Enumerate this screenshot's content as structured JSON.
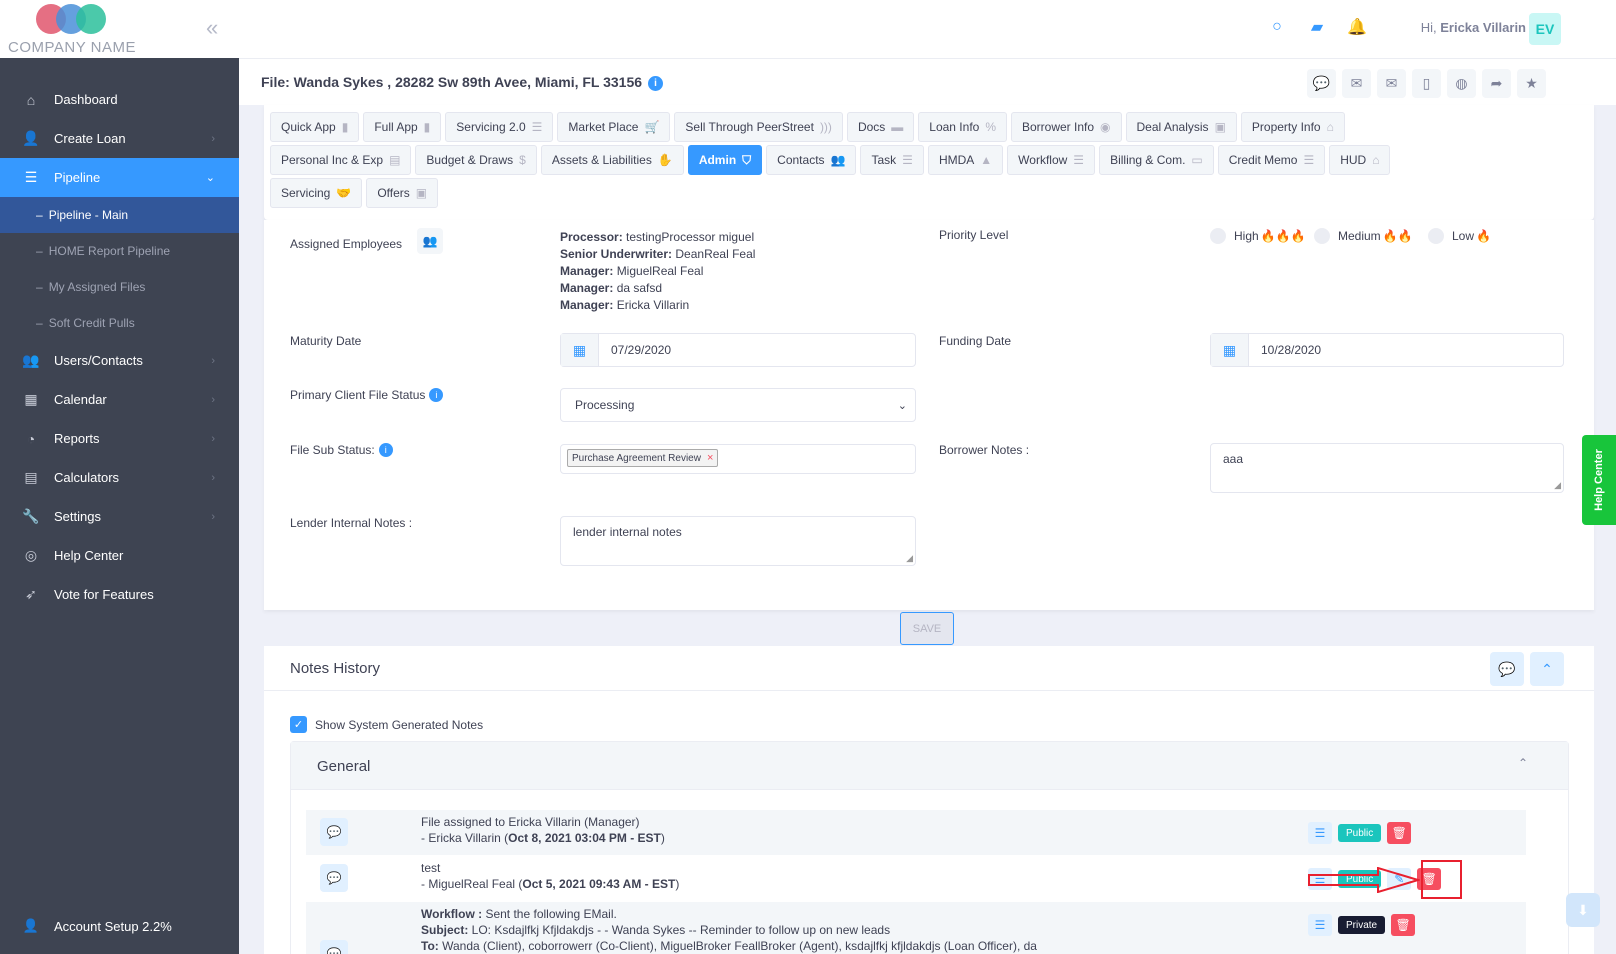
{
  "brand": {
    "company": "COMPANY NAME"
  },
  "sidebar": {
    "items": [
      {
        "label": "Dashboard",
        "icon": "home-icon"
      },
      {
        "label": "Create Loan",
        "icon": "user-plus-icon"
      },
      {
        "label": "Pipeline",
        "icon": "list-icon"
      },
      {
        "label": "Pipeline - Main"
      },
      {
        "label": "HOME Report Pipeline"
      },
      {
        "label": "My Assigned Files"
      },
      {
        "label": "Soft Credit Pulls"
      },
      {
        "label": "Users/Contacts",
        "icon": "users-icon"
      },
      {
        "label": "Calendar",
        "icon": "calendar-icon"
      },
      {
        "label": "Reports",
        "icon": "chart-icon"
      },
      {
        "label": "Calculators",
        "icon": "calculator-icon"
      },
      {
        "label": "Settings",
        "icon": "wrench-icon"
      },
      {
        "label": "Help Center",
        "icon": "lifebuoy-icon"
      },
      {
        "label": "Vote for Features",
        "icon": "rocket-icon"
      }
    ],
    "account_setup": "Account Setup 2.2%"
  },
  "header": {
    "greeting": "Hi,",
    "user_name": "Ericka Villarin",
    "initials": "EV"
  },
  "file": {
    "title": "File: Wanda Sykes , 28282 Sw 89th Avee, Miami, FL 33156"
  },
  "tabs": {
    "row1": [
      "Quick App",
      "Full App",
      "Servicing 2.0",
      "Market Place",
      "Sell Through PeerStreet",
      "Docs",
      "Loan Info",
      "Borrower Info",
      "Deal Analysis",
      "Property Info"
    ],
    "row2": [
      "Personal Inc & Exp",
      "Budget & Draws",
      "Assets & Liabilities",
      "Admin",
      "Contacts",
      "Task",
      "HMDA",
      "Workflow",
      "Billing & Com.",
      "Credit Memo",
      "HUD"
    ],
    "row3": [
      "Servicing",
      "Offers"
    ]
  },
  "form": {
    "assigned_label": "Assigned Employees",
    "employees": [
      {
        "role": "Processor:",
        "name": "testingProcessor miguel"
      },
      {
        "role": "Senior Underwriter:",
        "name": "DeanReal Feal"
      },
      {
        "role": "Manager:",
        "name": "MiguelReal Feal"
      },
      {
        "role": "Manager:",
        "name": "da safsd"
      },
      {
        "role": "Manager:",
        "name": "Ericka Villarin"
      }
    ],
    "priority_label": "Priority Level",
    "priority_high": "High",
    "priority_medium": "Medium",
    "priority_low": "Low",
    "maturity_label": "Maturity Date",
    "maturity_value": "07/29/2020",
    "funding_label": "Funding Date",
    "funding_value": "10/28/2020",
    "status_label": "Primary Client File Status",
    "status_value": "Processing",
    "substatus_label": "File Sub Status:",
    "substatus_chip": "Purchase Agreement Review",
    "borrower_notes_label": "Borrower Notes :",
    "borrower_notes_value": "aaa",
    "lender_notes_label": "Lender Internal Notes :",
    "lender_notes_value": "lender internal notes",
    "save": "SAVE"
  },
  "notes": {
    "title": "Notes History",
    "show_system": "Show System Generated Notes",
    "section": "General",
    "rows": [
      {
        "line1": "File assigned to Ericka Villarin (Manager)",
        "by": "- Ericka Villarin (",
        "date": "Oct 8, 2021 03:04 PM - EST",
        "close": ")",
        "badge": "Public"
      },
      {
        "line1": "test",
        "by": "- MiguelReal Feal (",
        "date": "Oct 5, 2021 09:43 AM - EST",
        "close": ")",
        "badge": "Public"
      },
      {
        "wf_label": "Workflow :",
        "wf_text": " Sent the following EMail.",
        "subj_label": "Subject:",
        "subj_text": " LO: Ksdajlfkj Kfjldakdjs - - Wanda Sykes -- Reminder to follow up on new leads",
        "to_label": "To:",
        "to_text": " Wanda (Client), coborrowerr (Co-Client), MiguelBroker FeallBroker (Agent), ksdajlfkj kfjldakdjs (Loan Officer), da",
        "badge": "Private"
      }
    ]
  },
  "help_center": "Help Center"
}
